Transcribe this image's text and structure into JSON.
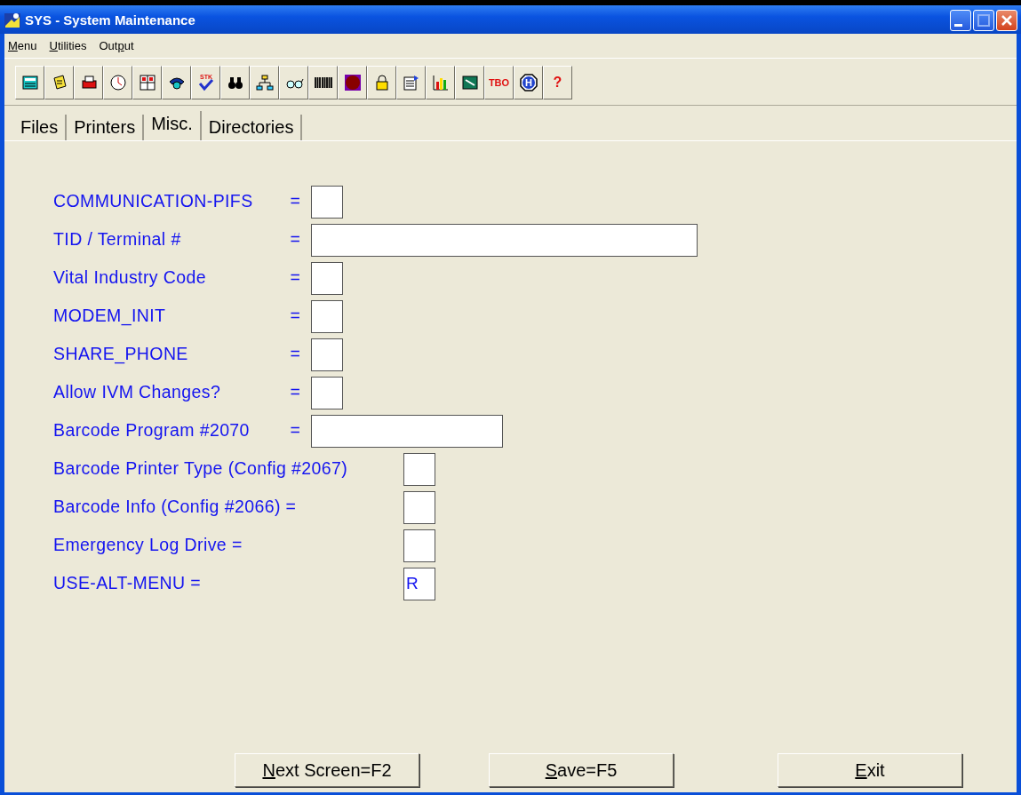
{
  "window": {
    "title": "SYS - System Maintenance"
  },
  "menu": [
    {
      "key": "M",
      "after": "enu"
    },
    {
      "key": "U",
      "after": "tilities"
    },
    {
      "before": "Out",
      "key": "p",
      "after": "ut"
    }
  ],
  "toolbar": [
    {
      "kind": "calculator"
    },
    {
      "kind": "notepad"
    },
    {
      "kind": "printer"
    },
    {
      "kind": "clock"
    },
    {
      "kind": "grid"
    },
    {
      "kind": "phone"
    },
    {
      "kind": "check",
      "glyph": "STK"
    },
    {
      "kind": "binoculars"
    },
    {
      "kind": "tree"
    },
    {
      "kind": "glasses"
    },
    {
      "kind": "barcode"
    },
    {
      "kind": "target"
    },
    {
      "kind": "lock"
    },
    {
      "kind": "form"
    },
    {
      "kind": "chart"
    },
    {
      "kind": "image"
    },
    {
      "kind": "text",
      "glyph": "TBO"
    },
    {
      "kind": "hexagon",
      "glyph": "H"
    },
    {
      "kind": "text",
      "glyph": "?"
    }
  ],
  "tabs": [
    {
      "label": "Files",
      "selected": false
    },
    {
      "label": "Printers",
      "selected": false
    },
    {
      "label": "Misc.",
      "selected": true
    },
    {
      "label": "Directories",
      "selected": false
    }
  ],
  "fields": [
    {
      "label": "COMMUNICATION-PIFS",
      "equals": "=",
      "kind": "box"
    },
    {
      "label": "TID / Terminal #",
      "equals": "=",
      "kind": "wide"
    },
    {
      "label": "Vital Industry Code",
      "equals": "=",
      "kind": "box"
    },
    {
      "label": "MODEM_INIT",
      "equals": "=",
      "kind": "box"
    },
    {
      "label": "SHARE_PHONE",
      "equals": "=",
      "kind": "box"
    },
    {
      "label": "Allow IVM Changes?",
      "equals": "=",
      "kind": "box"
    },
    {
      "label": "Barcode Program #2070",
      "equals": "=",
      "kind": "medium"
    },
    {
      "label": "Barcode Printer Type (Config #2067)",
      "kind": "offset"
    },
    {
      "label": "Barcode Info (Config #2066) =",
      "kind": "offset"
    },
    {
      "label": "Emergency Log Drive =",
      "kind": "offset"
    },
    {
      "label": "USE-ALT-MENU =",
      "kind": "offset",
      "value": "R"
    }
  ],
  "buttons": [
    {
      "key": "N",
      "after": "ext Screen=F2"
    },
    {
      "key": "S",
      "after": "ave=F5"
    },
    {
      "key": "E",
      "after": "xit"
    }
  ]
}
